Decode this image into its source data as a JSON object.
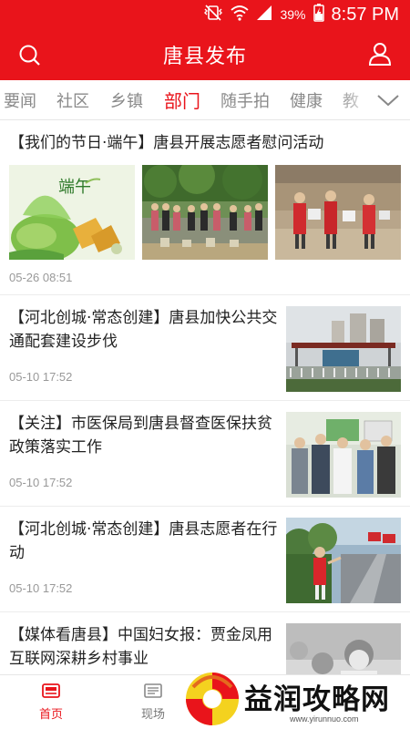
{
  "status_bar": {
    "battery_percent": "39%",
    "time": "8:57 PM",
    "icons": [
      "vibrate-off-icon",
      "wifi-icon",
      "signal-icon",
      "battery-charging-icon"
    ]
  },
  "header": {
    "title": "唐县发布",
    "left_icon": "search-icon",
    "right_icon": "user-icon"
  },
  "tabs": {
    "items": [
      {
        "label": "要闻",
        "active": false
      },
      {
        "label": "社区",
        "active": false
      },
      {
        "label": "乡镇",
        "active": false
      },
      {
        "label": "部门",
        "active": true
      },
      {
        "label": "随手拍",
        "active": false
      },
      {
        "label": "健康",
        "active": false
      },
      {
        "label": "教",
        "active": false
      }
    ],
    "more_icon": "chevron-down-icon"
  },
  "articles": [
    {
      "title": "【我们的节日·端午】唐县开展志愿者慰问活动",
      "date": "05-26 08:51",
      "thumb_text": "端午"
    },
    {
      "title": "【河北创城·常态创建】唐县加快公共交通配套建设步伐",
      "date": "05-10 17:52"
    },
    {
      "title": "【关注】市医保局到唐县督查医保扶贫政策落实工作",
      "date": "05-10 17:52"
    },
    {
      "title": "【河北创城·常态创建】唐县志愿者在行动",
      "date": "05-10 17:52"
    },
    {
      "title": "【媒体看唐县】中国妇女报：贾金凤用互联网深耕乡村事业",
      "date": ""
    }
  ],
  "bottom_nav": {
    "items": [
      {
        "label": "首页",
        "icon": "home-icon",
        "active": true
      },
      {
        "label": "现场",
        "icon": "live-icon",
        "active": false
      }
    ]
  },
  "watermark": {
    "text": "益润攻略网",
    "url": "www.yirunnuo.com"
  },
  "colors": {
    "brand_red": "#e9141b",
    "tab_inactive": "#8a8a8a",
    "date_gray": "#999999"
  }
}
